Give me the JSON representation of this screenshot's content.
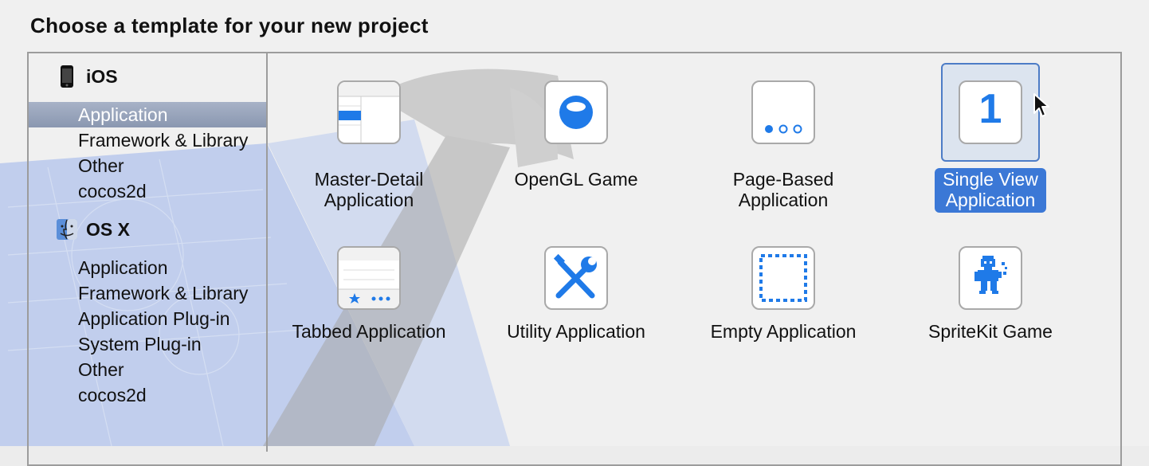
{
  "heading": "Choose a template for your new project",
  "sidebar": {
    "sections": [
      {
        "label": "iOS",
        "icon": "iphone-icon",
        "items": [
          {
            "label": "Application",
            "selected": true
          },
          {
            "label": "Framework & Library",
            "selected": false
          },
          {
            "label": "Other",
            "selected": false
          },
          {
            "label": "cocos2d",
            "selected": false
          }
        ]
      },
      {
        "label": "OS X",
        "icon": "finder-icon",
        "items": [
          {
            "label": "Application",
            "selected": false
          },
          {
            "label": "Framework & Library",
            "selected": false
          },
          {
            "label": "Application Plug-in",
            "selected": false
          },
          {
            "label": "System Plug-in",
            "selected": false
          },
          {
            "label": "Other",
            "selected": false
          },
          {
            "label": "cocos2d",
            "selected": false
          }
        ]
      }
    ]
  },
  "templates": [
    {
      "label_line1": "Master-Detail",
      "label_line2": "Application",
      "icon": "master-detail-icon",
      "selected": false
    },
    {
      "label_line1": "OpenGL Game",
      "label_line2": "",
      "icon": "opengl-sphere-icon",
      "selected": false
    },
    {
      "label_line1": "Page-Based",
      "label_line2": "Application",
      "icon": "page-dots-icon",
      "selected": false
    },
    {
      "label_line1": "Single View",
      "label_line2": "Application",
      "icon": "single-view-icon",
      "icon_text": "1",
      "selected": true
    },
    {
      "label_line1": "Tabbed Application",
      "label_line2": "",
      "icon": "tab-bar-icon",
      "selected": false
    },
    {
      "label_line1": "Utility Application",
      "label_line2": "",
      "icon": "wrench-screwdriver-icon",
      "selected": false
    },
    {
      "label_line1": "Empty Application",
      "label_line2": "",
      "icon": "dashed-square-icon",
      "selected": false
    },
    {
      "label_line1": "SpriteKit Game",
      "label_line2": "",
      "icon": "sprite-character-icon",
      "selected": false
    }
  ],
  "colors": {
    "accent": "#3b78d6",
    "icon_blue": "#1f7ae8",
    "sidebar_selection": "#8a97b0"
  }
}
